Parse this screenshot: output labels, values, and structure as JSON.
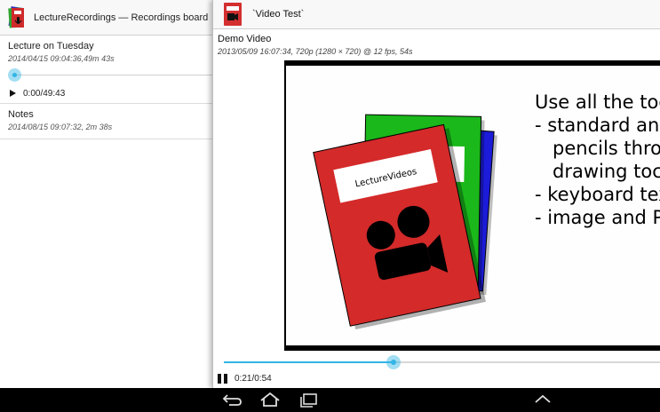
{
  "left_pane": {
    "title": "LectureRecordings — Recordings board",
    "items": [
      {
        "title": "Lecture on Tuesday",
        "meta": "2014/04/15 09:04:36,49m 43s",
        "progress": 0.0,
        "time": "0:00/49:43"
      },
      {
        "title": "Notes",
        "meta": "2014/08/15 09:07:32, 2m 38s"
      }
    ]
  },
  "right_pane": {
    "title": "`Video Test`",
    "video": {
      "name": "Demo Video",
      "meta": "2013/05/09 16:07:34, 720p (1280 × 720) @ 12 fps, 54s",
      "progress": 0.39,
      "time": "0:21/0:54",
      "slide": {
        "lines": [
          "Use all the toc",
          "- standard anc",
          "   pencils thro",
          "   drawing toc",
          "- keyboard tex",
          "- image and P"
        ],
        "book_label": "LectureVideos",
        "book_colors": {
          "front": "#d42a2a",
          "middle": "#1ab81a",
          "back": "#1b1bd9"
        }
      }
    },
    "paused": true
  },
  "navbar": {
    "buttons": [
      "back-icon",
      "home-icon",
      "recent-apps-icon",
      "collapse-up-icon"
    ]
  },
  "colors": {
    "accent": "#33b5e5",
    "app_red": "#d32f2f",
    "navbar": "#000000"
  }
}
